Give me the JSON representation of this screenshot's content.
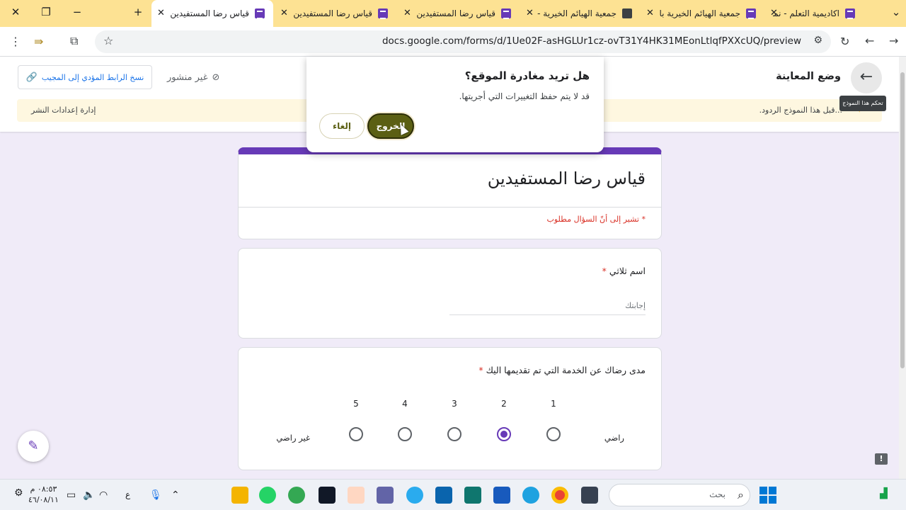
{
  "browser": {
    "tabs": [
      {
        "label": "قياس رضا المستفيدين",
        "active": true
      },
      {
        "label": "قياس رضا المستفيدين",
        "active": false
      },
      {
        "label": "قياس رضا المستفيدين",
        "active": false
      },
      {
        "label": "جمعية الهيائم الخيرية -",
        "active": false
      },
      {
        "label": "جمعية الهيائم الخيرية با",
        "active": false
      },
      {
        "label": "اكاديمية التعلم - نماذج",
        "active": false
      }
    ],
    "url": "docs.google.com/forms/d/1Ue02F-asHGLUr1cz-ovT31Y4HK31MEonLtlqfPXXcUQ/preview"
  },
  "forms_header": {
    "preview_mode": "وضع المعاينة",
    "copy_link": "نسخ الرابط المؤدي إلى المجيب",
    "unpublished": "غير منشور",
    "banner_right": "...قبل هذا النموذج الردود.",
    "banner_left": "إدارة إعدادات النشر",
    "tooltip": "تحكم هذا النموذج"
  },
  "dialog": {
    "title": "هل تريد مغادرة الموقع؟",
    "body": "قد لا يتم حفظ التغييرات التي أجريتها.",
    "leave_label": "الخروج",
    "cancel_label": "إلغاء"
  },
  "form": {
    "title": "قياس رضا المستفيدين",
    "required_note": "* تشير إلى أنّ السؤال مطلوب",
    "q1": {
      "label": "اسم ثلاثي",
      "placeholder": "إجابتك"
    },
    "q2": {
      "label": "مدى رضاك عن الخدمة التي تم تقديمها اليك",
      "scale": [
        "1",
        "2",
        "3",
        "4",
        "5"
      ],
      "selected": "2",
      "low_label": "راضي",
      "high_label": "غير راضي"
    }
  },
  "taskbar": {
    "search_placeholder": "بحث",
    "time": "٠٨:٥٣ م",
    "date": "٤٦/٠٨/١١",
    "lang": "ع"
  },
  "colors": {
    "accent": "#673ab7",
    "tabstrip": "#fde293",
    "leave_button": "#5b5f13"
  }
}
